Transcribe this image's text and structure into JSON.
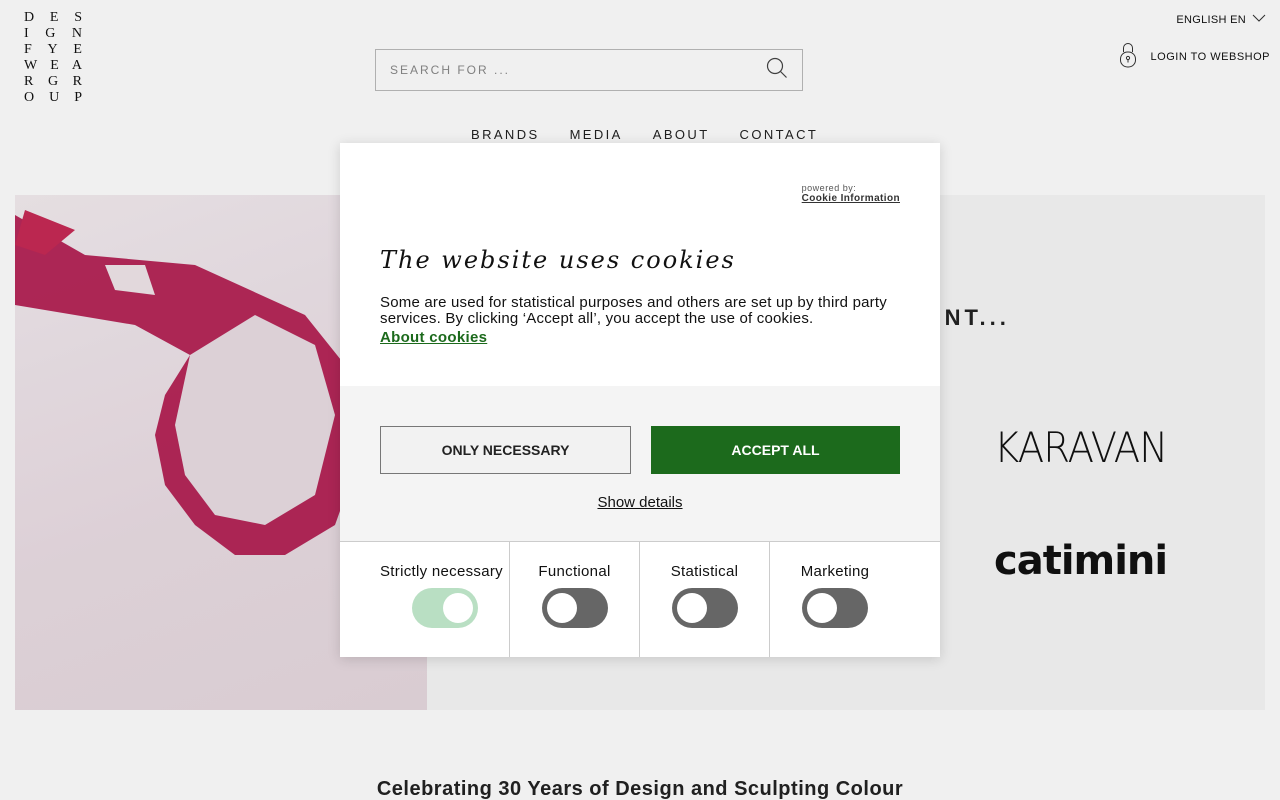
{
  "site": {
    "logo_letters": [
      [
        "D",
        "E",
        "S"
      ],
      [
        "I",
        "G",
        "N"
      ],
      [
        "F",
        "Y",
        "E"
      ],
      [
        "W",
        "E",
        "A"
      ],
      [
        "R",
        "G",
        "R"
      ],
      [
        "O",
        "U",
        "P"
      ]
    ],
    "language": "ENGLISH EN",
    "login": "LOGIN TO WEBSHOP",
    "search": {
      "placeholder": "SEARCH FOR ..."
    },
    "nav": [
      "BRANDS",
      "MEDIA",
      "ABOUT",
      "CONTACT"
    ],
    "hero_text": "ENT...",
    "brands": [
      "KARAVAN",
      "catimini"
    ],
    "subtitle": "Celebrating 30 Years of Design and Sculpting Colour"
  },
  "cookie_dialog": {
    "powered_label": "powered by:",
    "powered_link": "Cookie Information",
    "title": "The website uses cookies",
    "text": "Some are used for statistical purposes and others are set up by third party services. By clicking ‘Accept all’, you accept the use of cookies.",
    "about_link": "About cookies",
    "only_necessary": "ONLY NECESSARY",
    "accept_all": "ACCEPT ALL",
    "show_details": "Show details",
    "categories": [
      {
        "label": "Strictly necessary",
        "enabled": true
      },
      {
        "label": "Functional",
        "enabled": false
      },
      {
        "label": "Statistical",
        "enabled": false
      },
      {
        "label": "Marketing",
        "enabled": false
      }
    ],
    "accent_color": "#1c6a1c"
  }
}
